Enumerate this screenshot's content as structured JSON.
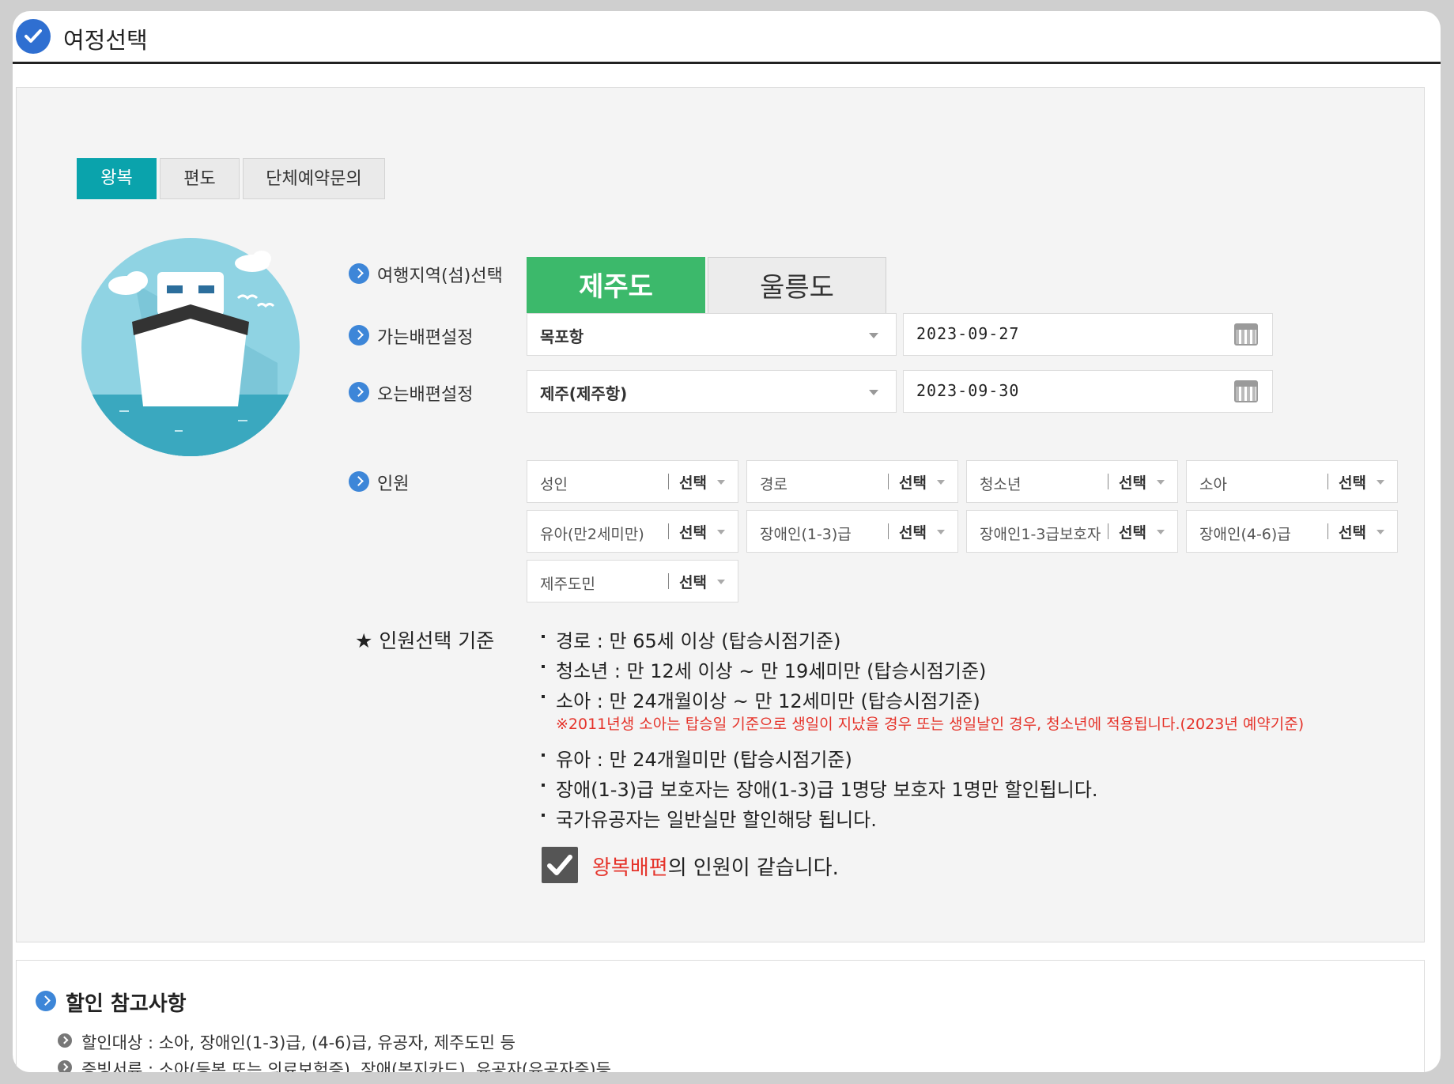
{
  "header": {
    "title": "여정선택"
  },
  "tabs": [
    {
      "label": "왕복",
      "active": true
    },
    {
      "label": "편도",
      "active": false
    },
    {
      "label": "단체예약문의",
      "active": false
    }
  ],
  "form": {
    "region": {
      "label": "여행지역(섬)선택",
      "options": [
        {
          "label": "제주도",
          "selected": true
        },
        {
          "label": "울릉도",
          "selected": false
        }
      ]
    },
    "outbound": {
      "label": "가는배편설정",
      "port": "목포항",
      "date": "2023-09-27"
    },
    "inbound": {
      "label": "오는배편설정",
      "port": "제주(제주항)",
      "date": "2023-09-30"
    },
    "passengers": {
      "label": "인원",
      "select_label": "선택",
      "types": [
        "성인",
        "경로",
        "청소년",
        "소아",
        "유아(만2세미만)",
        "장애인(1-3)급",
        "장애인1-3급보호자",
        "장애인(4-6)급",
        "제주도민"
      ]
    }
  },
  "criteria": {
    "title": "★ 인원선택 기준",
    "rules": [
      "경로 : 만 65세 이상 (탑승시점기준)",
      "청소년 : 만 12세 이상 ~ 만 19세미만 (탑승시점기준)",
      "소아 : 만 24개월이상 ~ 만 12세미만 (탑승시점기준)",
      "유아 : 만 24개월미만 (탑승시점기준)",
      "장애(1-3)급 보호자는 장애(1-3)급 1명당 보호자 1명만 할인됩니다.",
      "국가유공자는 일반실만 할인해당 됩니다."
    ],
    "note": "※2011년생 소아는 탑승일 기준으로 생일이 지났을 경우 또는 생일날인 경우, 청소년에 적용됩니다.(2023년 예약기준)"
  },
  "same_passengers": {
    "highlight": "왕복배편",
    "text": "의 인원이 같습니다.",
    "checked": true
  },
  "discount": {
    "title": "할인 참고사항",
    "items": [
      "할인대상 : 소아, 장애인(1-3)급, (4-6)급, 유공자, 제주도민 등",
      "증빙서류 : 소아(등본 또는 의료보험증), 장애(복지카드), 유공자(유공자증)등"
    ]
  },
  "colors": {
    "tab_active": "#0aa3ac",
    "island_selected": "#3cb96b",
    "accent_blue": "#2f6fd1",
    "warning_red": "#e5332a"
  }
}
